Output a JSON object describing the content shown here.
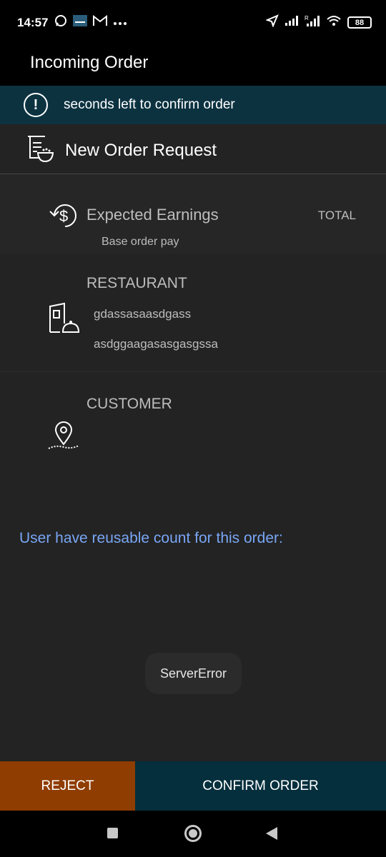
{
  "status_bar": {
    "time": "14:57",
    "battery": "88",
    "left_icons": [
      "whatsapp-icon",
      "app-thumbnail-icon",
      "gmail-icon",
      "more-dots-icon"
    ],
    "right_icons": [
      "location-arrow-icon",
      "signal-icon",
      "signal-roaming-icon",
      "wifi-icon",
      "battery-icon"
    ]
  },
  "app_bar": {
    "title": "Incoming Order"
  },
  "banner": {
    "icon": "alert-circle-icon",
    "text": "seconds left to confirm order"
  },
  "order": {
    "request_title": "New Order Request",
    "request_icon": "food-order-icon",
    "earnings": {
      "icon": "money-refresh-icon",
      "title": "Expected Earnings",
      "total_label": "TOTAL",
      "sub_label": "Base order pay"
    },
    "restaurant": {
      "label": "RESTAURANT",
      "icon": "restaurant-icon",
      "name": "gdassasaasdgass",
      "address": "asdggaagasasgasgssa"
    },
    "customer": {
      "label": "CUSTOMER",
      "icon": "map-pin-icon"
    },
    "reusable_text": "User have reusable count for this order:"
  },
  "toast": {
    "text": "ServerError"
  },
  "actions": {
    "reject_label": "REJECT",
    "confirm_label": "CONFIRM ORDER"
  },
  "colors": {
    "banner_bg": "#0c3240",
    "content_bg": "#232323",
    "reject_bg": "#8f3d00",
    "confirm_bg": "#052f3d",
    "link_blue": "#79a6f5"
  },
  "nav": {
    "icons": [
      "recents-square-icon",
      "home-circle-icon",
      "back-triangle-icon"
    ]
  }
}
